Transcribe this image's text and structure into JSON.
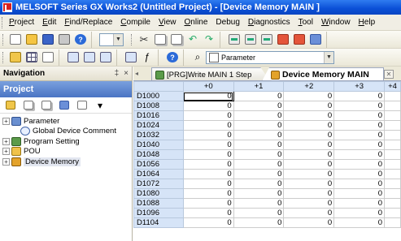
{
  "window": {
    "title": "MELSOFT Series GX Works2 (Untitled Project) - [Device Memory MAIN ]"
  },
  "menu": [
    {
      "label": "Project",
      "ul": "P",
      "rest": "roject"
    },
    {
      "label": "Edit",
      "ul": "E",
      "rest": "dit"
    },
    {
      "label": "Find/Replace",
      "ul": "F",
      "rest": "ind/Replace"
    },
    {
      "label": "Compile",
      "ul": "C",
      "rest": "ompile"
    },
    {
      "label": "View",
      "ul": "V",
      "rest": "iew"
    },
    {
      "label": "Online",
      "ul": "O",
      "rest": "nline"
    },
    {
      "label": "Debug",
      "ul": "",
      "rest": "Debug"
    },
    {
      "label": "Diagnostics",
      "ul": "D",
      "rest": "iagnostics"
    },
    {
      "label": "Tool",
      "ul": "T",
      "rest": "ool"
    },
    {
      "label": "Window",
      "ul": "W",
      "rest": "indow"
    },
    {
      "label": "Help",
      "ul": "H",
      "rest": "elp"
    }
  ],
  "toolbar": {
    "parameter_combo": "Parameter"
  },
  "navigation": {
    "title": "Navigation",
    "pin_glyph": "‡",
    "close_glyph": "×",
    "section": "Project",
    "tree": [
      {
        "label": "Parameter",
        "expander": "+",
        "indent": false,
        "icon": "parameter-icon"
      },
      {
        "label": "Global Device Comment",
        "expander": "",
        "indent": true,
        "icon": "comment-icon"
      },
      {
        "label": "Program Setting",
        "expander": "+",
        "indent": false,
        "icon": "program-setting-icon"
      },
      {
        "label": "POU",
        "expander": "+",
        "indent": false,
        "icon": "pou-icon"
      },
      {
        "label": "Device Memory",
        "expander": "+",
        "indent": false,
        "icon": "device-memory-icon"
      }
    ]
  },
  "tabs": [
    {
      "label": "[PRG]Write MAIN 1 Step",
      "active": false
    },
    {
      "label": "Device Memory MAIN",
      "active": true
    }
  ],
  "grid": {
    "columns": [
      "",
      "+0",
      "+1",
      "+2",
      "+3",
      "+4"
    ],
    "rows": [
      {
        "addr": "D1000",
        "vals": [
          "0",
          "0",
          "0",
          "0",
          ""
        ]
      },
      {
        "addr": "D1008",
        "vals": [
          "0",
          "0",
          "0",
          "0",
          ""
        ]
      },
      {
        "addr": "D1016",
        "vals": [
          "0",
          "0",
          "0",
          "0",
          ""
        ]
      },
      {
        "addr": "D1024",
        "vals": [
          "0",
          "0",
          "0",
          "0",
          ""
        ]
      },
      {
        "addr": "D1032",
        "vals": [
          "0",
          "0",
          "0",
          "0",
          ""
        ]
      },
      {
        "addr": "D1040",
        "vals": [
          "0",
          "0",
          "0",
          "0",
          ""
        ]
      },
      {
        "addr": "D1048",
        "vals": [
          "0",
          "0",
          "0",
          "0",
          ""
        ]
      },
      {
        "addr": "D1056",
        "vals": [
          "0",
          "0",
          "0",
          "0",
          ""
        ]
      },
      {
        "addr": "D1064",
        "vals": [
          "0",
          "0",
          "0",
          "0",
          ""
        ]
      },
      {
        "addr": "D1072",
        "vals": [
          "0",
          "0",
          "0",
          "0",
          ""
        ]
      },
      {
        "addr": "D1080",
        "vals": [
          "0",
          "0",
          "0",
          "0",
          ""
        ]
      },
      {
        "addr": "D1088",
        "vals": [
          "0",
          "0",
          "0",
          "0",
          ""
        ]
      },
      {
        "addr": "D1096",
        "vals": [
          "0",
          "0",
          "0",
          "0",
          ""
        ]
      },
      {
        "addr": "D1104",
        "vals": [
          "0",
          "0",
          "0",
          "0",
          ""
        ]
      }
    ]
  }
}
